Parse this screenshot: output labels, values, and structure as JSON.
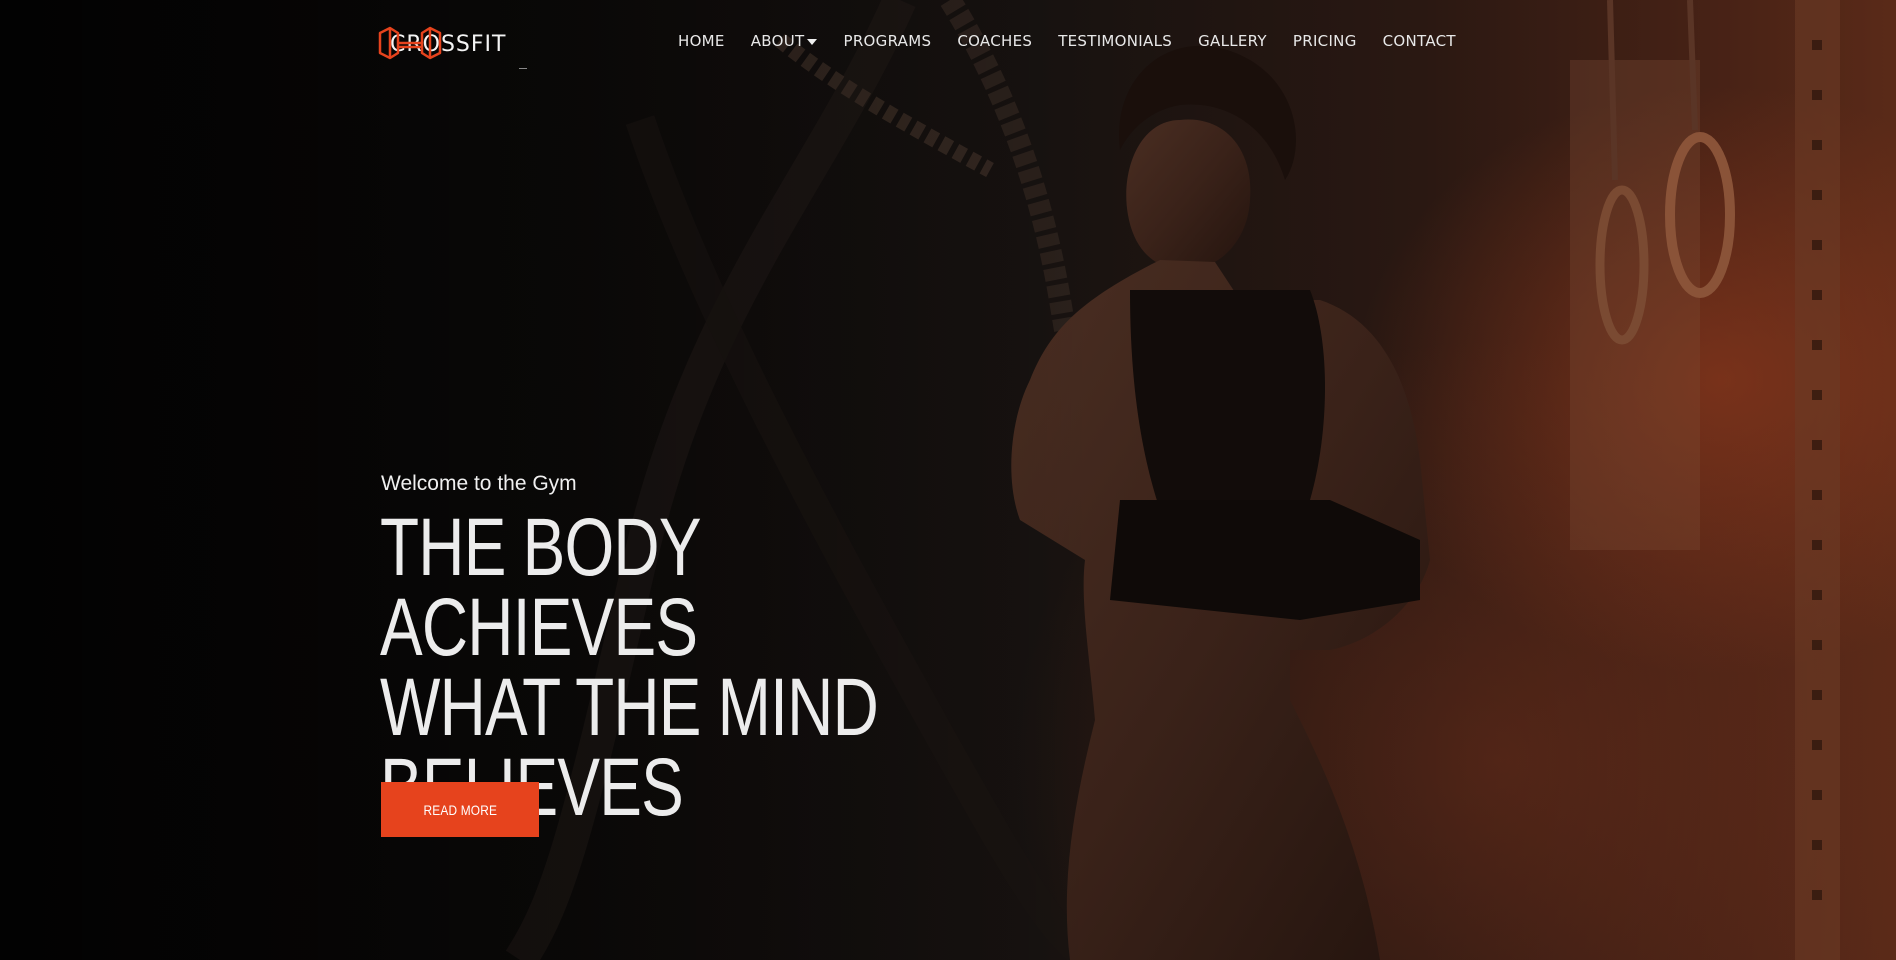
{
  "brand": {
    "name": "CROSSFIT",
    "logo_icon": "dumbbell-icon",
    "accent_color": "#e6431d"
  },
  "nav": {
    "items": [
      {
        "label": "HOME"
      },
      {
        "label": "ABOUT",
        "has_dropdown": true
      },
      {
        "label": "PROGRAMS"
      },
      {
        "label": "COACHES"
      },
      {
        "label": "TESTIMONIALS"
      },
      {
        "label": "GALLERY"
      },
      {
        "label": "PRICING"
      },
      {
        "label": "CONTACT"
      }
    ]
  },
  "hero": {
    "eyebrow": "Welcome to the Gym",
    "headline_lines": [
      "THE BODY ACHIEVES",
      "WHAT THE MIND",
      "BELIEVES"
    ],
    "cta_label": "READ MORE"
  }
}
